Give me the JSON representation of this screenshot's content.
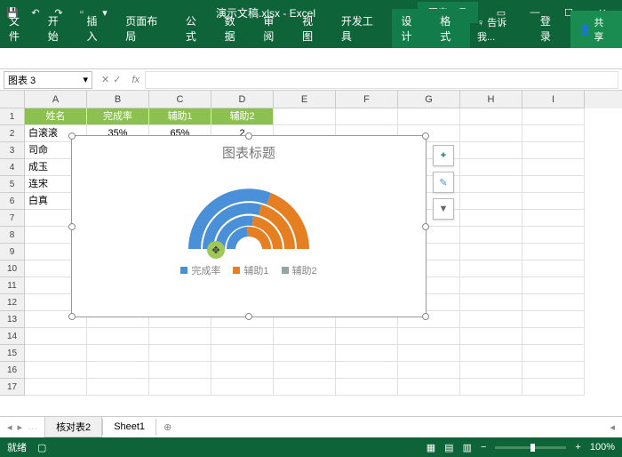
{
  "titlebar": {
    "filename": "演示文稿.xlsx - Excel",
    "toolsLabel": "图表工具"
  },
  "tabs": {
    "file": "文件",
    "home": "开始",
    "insert": "插入",
    "layout": "页面布局",
    "formula": "公式",
    "data": "数据",
    "review": "审阅",
    "view": "视图",
    "dev": "开发工具",
    "design": "设计",
    "format": "格式",
    "tell": "告诉我...",
    "login": "登录",
    "share": "共享"
  },
  "namebox": "图表 3",
  "sheetData": {
    "headers": [
      "姓名",
      "完成率",
      "辅助1",
      "辅助2"
    ],
    "rows": [
      [
        "白滚滚",
        "35%",
        "65%",
        "2"
      ],
      [
        "司命",
        "",
        "",
        ""
      ],
      [
        "成玉",
        "",
        "",
        ""
      ],
      [
        "连宋",
        "",
        "",
        ""
      ],
      [
        "白真",
        "",
        "",
        ""
      ]
    ]
  },
  "chart": {
    "title": "图表标题",
    "legend": [
      "完成率",
      "辅助1",
      "辅助2"
    ]
  },
  "chart_data": {
    "type": "pie",
    "title": "图表标题",
    "series": [
      {
        "name": "完成率",
        "color": "#4a90d9"
      },
      {
        "name": "辅助1",
        "color": "#e67e22"
      },
      {
        "name": "辅助2",
        "color": "#95a5a6"
      }
    ],
    "note": "Multi-ring nested donut (fan) chart; exact radial values not labeled"
  },
  "sheets": {
    "tab1": "核对表2",
    "tab2": "Sheet1"
  },
  "status": {
    "ready": "就绪",
    "zoom": "100%"
  },
  "cols": [
    "A",
    "B",
    "C",
    "D",
    "E",
    "F",
    "G",
    "H",
    "I"
  ]
}
